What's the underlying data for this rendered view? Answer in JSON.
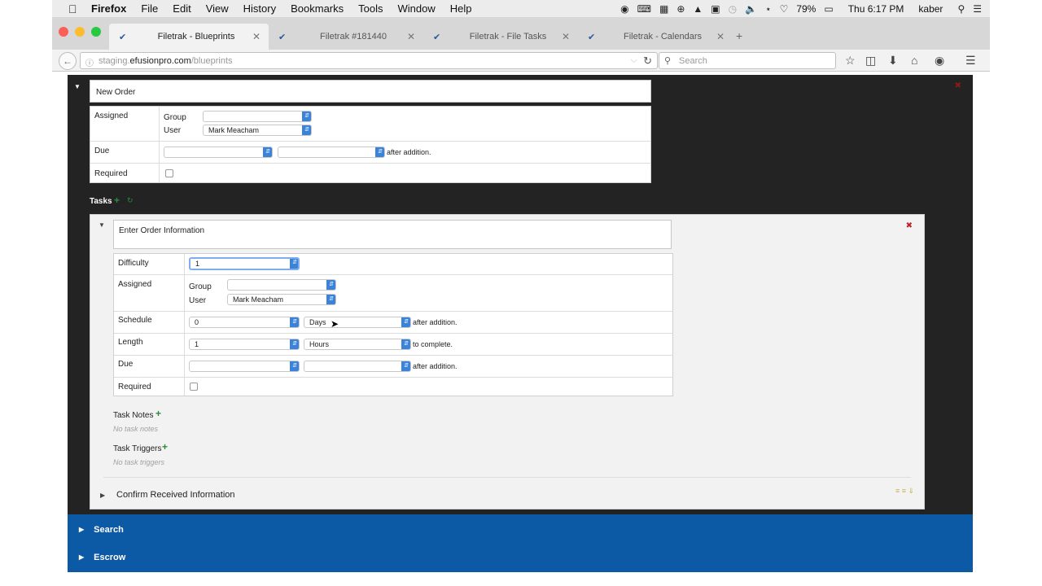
{
  "menubar": {
    "app": "Firefox",
    "items": [
      "File",
      "Edit",
      "View",
      "History",
      "Bookmarks",
      "Tools",
      "Window",
      "Help"
    ],
    "battery": "79%",
    "clock": "Thu 6:17 PM",
    "user": "kaber"
  },
  "tabs": [
    {
      "title": "Filetrak - Blueprints",
      "active": true
    },
    {
      "title": "Filetrak #181440",
      "active": false
    },
    {
      "title": "Filetrak - File Tasks",
      "active": false
    },
    {
      "title": "Filetrak - Calendars",
      "active": false
    }
  ],
  "urlbar": {
    "prefix": "staging.",
    "host": "efusionpro.com",
    "path": "/blueprints"
  },
  "searchbar": {
    "placeholder": "Search"
  },
  "blueprint": {
    "name": "New Order",
    "assigned_label": "Assigned",
    "group_label": "Group",
    "group_value": "",
    "user_label": "User",
    "user_value": "Mark Meacham",
    "due_label": "Due",
    "due_suffix": "after addition.",
    "required_label": "Required"
  },
  "tasks_label": "Tasks",
  "task": {
    "name": "Enter Order Information",
    "difficulty_label": "Difficulty",
    "difficulty_value": "1",
    "assigned_label": "Assigned",
    "group_label": "Group",
    "group_value": "",
    "user_label": "User",
    "user_value": "Mark Meacham",
    "schedule_label": "Schedule",
    "schedule_value": "0",
    "schedule_unit": "Days",
    "schedule_suffix": "after addition.",
    "length_label": "Length",
    "length_value": "1",
    "length_unit": "Hours",
    "length_suffix": "to complete.",
    "due_label": "Due",
    "due_suffix": "after addition.",
    "required_label": "Required",
    "notes_label": "Task Notes",
    "notes_empty": "No task notes",
    "triggers_label": "Task Triggers",
    "triggers_empty": "No task triggers"
  },
  "collapsed_task": "Confirm Received Information",
  "sections": [
    "Search",
    "Escrow"
  ],
  "colors": {
    "accent_blue": "#0c5aa5",
    "dark_bg": "#232323",
    "select_arrow": "#3b83d8",
    "delete_red": "#c0202a",
    "add_green": "#2c8a3c"
  }
}
